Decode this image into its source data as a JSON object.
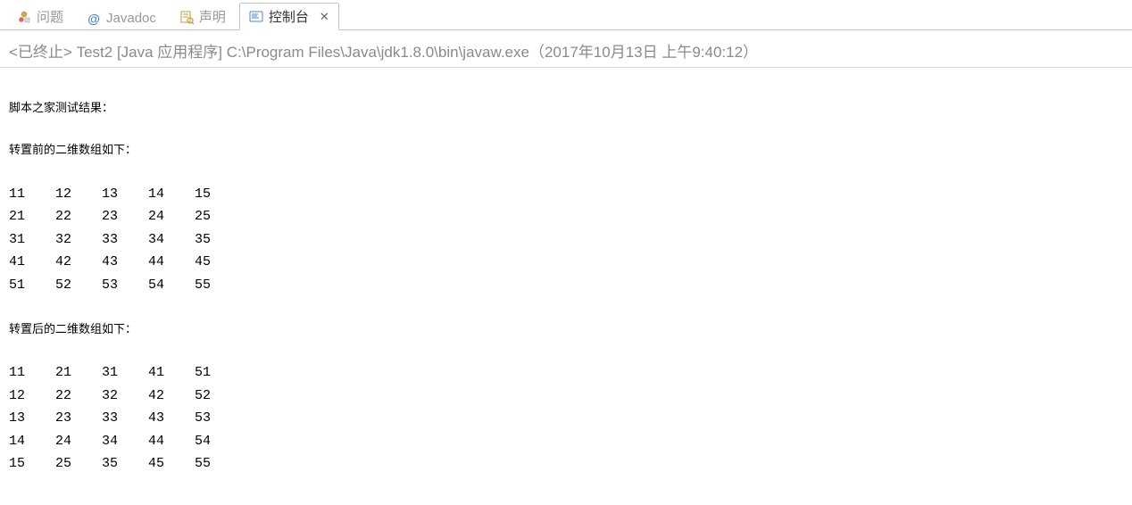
{
  "tabs": {
    "problems": {
      "label": "问题"
    },
    "javadoc": {
      "label": "Javadoc"
    },
    "declaration": {
      "label": "声明"
    },
    "console": {
      "label": "控制台"
    }
  },
  "status": {
    "prefix": "<已终止> ",
    "text": "Test2 [Java 应用程序] C:\\Program Files\\Java\\jdk1.8.0\\bin\\javaw.exe（2017年10月13日 上午9:40:12）"
  },
  "output": {
    "title": "脚本之家测试结果：",
    "before_heading": "转置前的二维数组如下：",
    "before_matrix": [
      [
        "11",
        "12",
        "13",
        "14",
        "15"
      ],
      [
        "21",
        "22",
        "23",
        "24",
        "25"
      ],
      [
        "31",
        "32",
        "33",
        "34",
        "35"
      ],
      [
        "41",
        "42",
        "43",
        "44",
        "45"
      ],
      [
        "51",
        "52",
        "53",
        "54",
        "55"
      ]
    ],
    "after_heading": "转置后的二维数组如下：",
    "after_matrix": [
      [
        "11",
        "21",
        "31",
        "41",
        "51"
      ],
      [
        "12",
        "22",
        "32",
        "42",
        "52"
      ],
      [
        "13",
        "23",
        "33",
        "43",
        "53"
      ],
      [
        "14",
        "24",
        "34",
        "44",
        "54"
      ],
      [
        "15",
        "25",
        "35",
        "45",
        "55"
      ]
    ]
  }
}
